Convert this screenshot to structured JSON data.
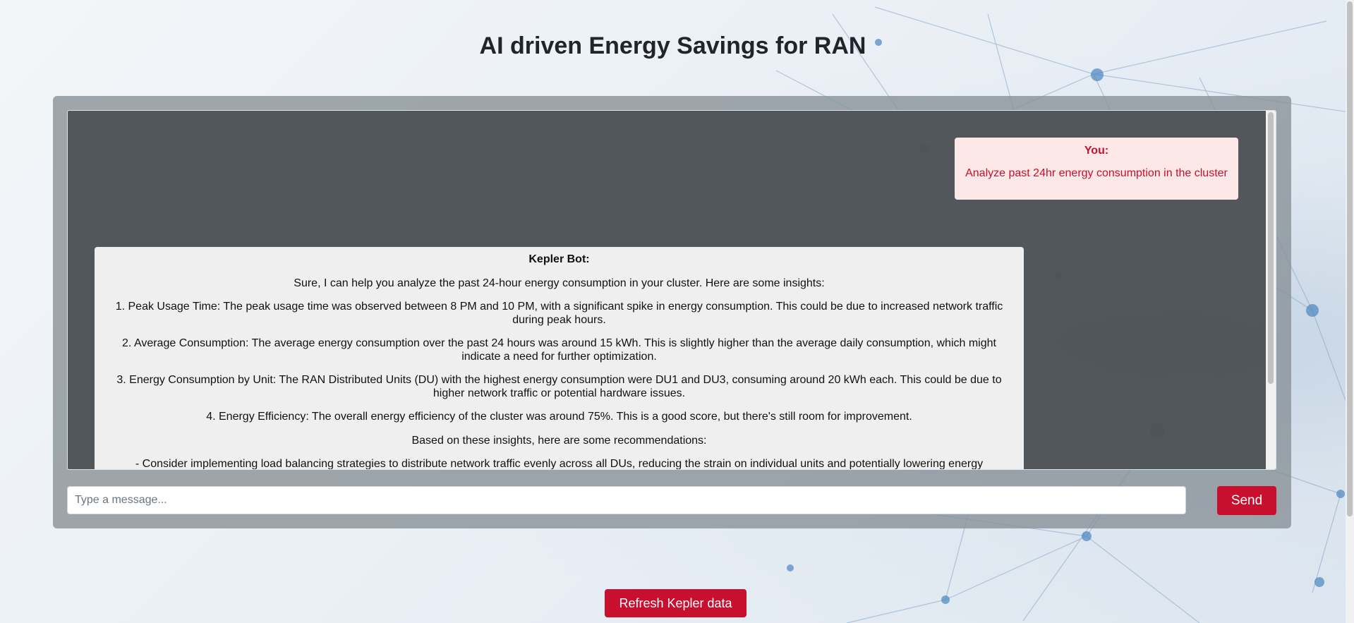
{
  "page": {
    "title": "AI driven Energy Savings for RAN"
  },
  "chat": {
    "messages": [
      {
        "sender": "You:",
        "text": "Analyze past 24hr energy consumption in the cluster"
      },
      {
        "sender": "Kepler Bot:",
        "paragraphs": [
          "Sure, I can help you analyze the past 24-hour energy consumption in your cluster. Here are some insights:",
          "1. Peak Usage Time: The peak usage time was observed between 8 PM and 10 PM, with a significant spike in energy consumption. This could be due to increased network traffic during peak hours.",
          "2. Average Consumption: The average energy consumption over the past 24 hours was around 15 kWh. This is slightly higher than the average daily consumption, which might indicate a need for further optimization.",
          "3. Energy Consumption by Unit: The RAN Distributed Units (DU) with the highest energy consumption were DU1 and DU3, consuming around 20 kWh each. This could be due to higher network traffic or potential hardware issues.",
          "4. Energy Efficiency: The overall energy efficiency of the cluster was around 75%. This is a good score, but there's still room for improvement.",
          "Based on these insights, here are some recommendations:",
          "- Consider implementing load balancing strategies to distribute network traffic evenly across all DUs, reducing the strain on individual units and potentially lowering energy"
        ]
      }
    ],
    "input": {
      "placeholder": "Type a message...",
      "value": ""
    },
    "send_label": "Send"
  },
  "footer": {
    "refresh_label": "Refresh Kepler data"
  },
  "colors": {
    "accent": "#c8102e",
    "user_bubble": "#fde8e8",
    "bot_bubble": "#efefef",
    "panel": "#878f96",
    "chat_window": "#464a4e"
  }
}
